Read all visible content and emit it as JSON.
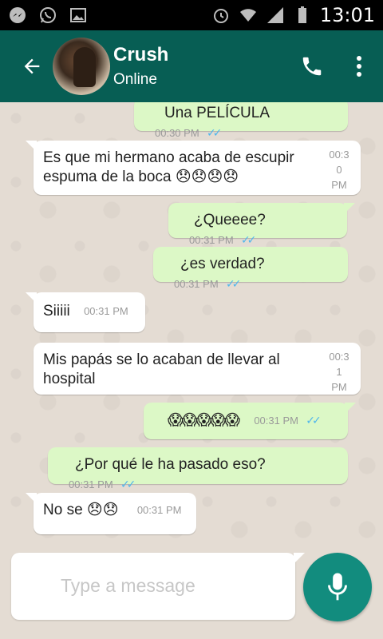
{
  "status_bar": {
    "time": "13:01"
  },
  "header": {
    "title": "Crush",
    "subtitle": "Online"
  },
  "messages": [
    {
      "dir": "out",
      "text": "Una PELÍCULA",
      "time": "00:30 PM"
    },
    {
      "dir": "in",
      "text_line1": "Es que mi hermano acaba de escupir",
      "text_line2": "espuma de la boca 😞😞😞😞",
      "time_lines": [
        "00:3",
        "0",
        "PM"
      ]
    },
    {
      "dir": "out",
      "text": "¿Queeee?",
      "time": "00:31 PM"
    },
    {
      "dir": "out",
      "text": "¿es verdad?",
      "time": "00:31 PM"
    },
    {
      "dir": "in",
      "text": "Siiiii",
      "time": "00:31 PM"
    },
    {
      "dir": "in",
      "text_line1": "Mis papás se lo acaban de llevar al",
      "text_line2": "hospital",
      "time_lines": [
        "00:3",
        "1",
        "PM"
      ]
    },
    {
      "dir": "out",
      "text": "😱😱😱😱😱",
      "time": "00:31 PM"
    },
    {
      "dir": "out",
      "text": "¿Por qué le ha pasado eso?",
      "time": "00:31 PM"
    },
    {
      "dir": "in",
      "text": "No se 😞😞",
      "time": "00:31 PM"
    }
  ],
  "composer": {
    "placeholder": "Type a message"
  },
  "colors": {
    "appbar": "#075e54",
    "outgoing": "#dcf8c6",
    "incoming": "#ffffff",
    "mic": "#128c7e",
    "ticks": "#4fb6ec"
  }
}
